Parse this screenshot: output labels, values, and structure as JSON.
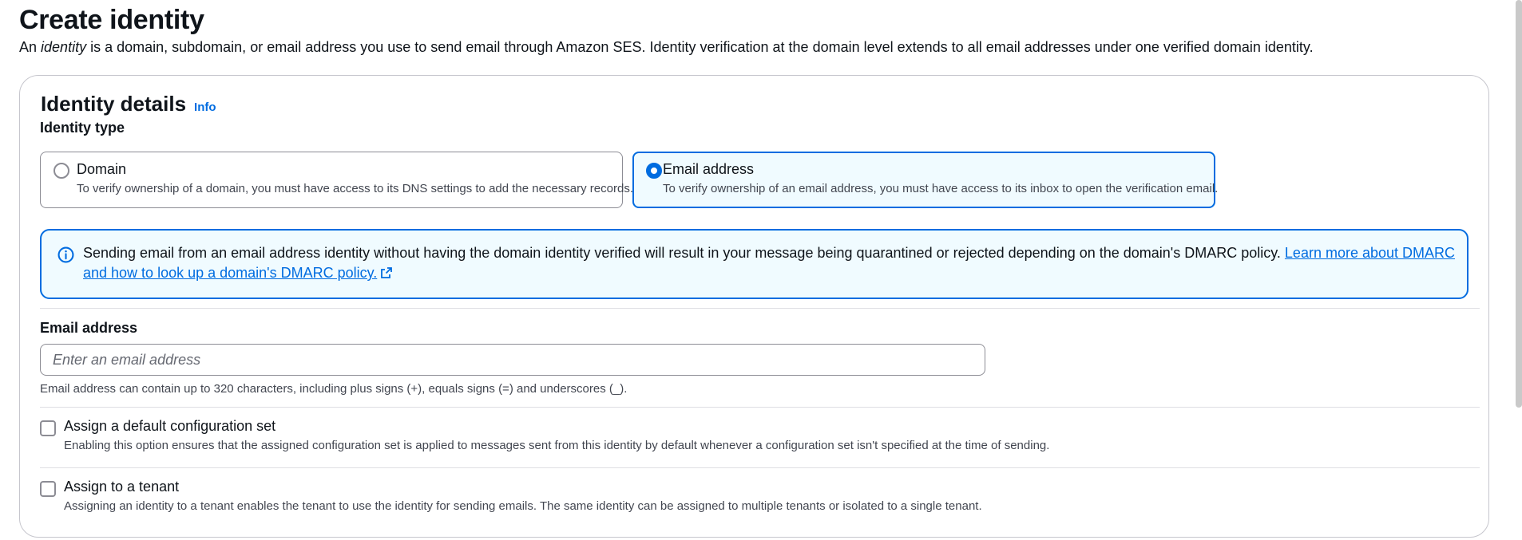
{
  "page": {
    "title": "Create identity",
    "description_prefix": "An ",
    "description_italic": "identity",
    "description_rest": " is a domain, subdomain, or email address you use to send email through Amazon SES. Identity verification at the domain level extends to all email addresses under one verified domain identity."
  },
  "panel": {
    "title": "Identity details",
    "info_label": "Info"
  },
  "identity_type": {
    "label": "Identity type",
    "selected": "email",
    "options": [
      {
        "key": "domain",
        "label": "Domain",
        "description": "To verify ownership of a domain, you must have access to its DNS settings to add the necessary records."
      },
      {
        "key": "email",
        "label": "Email address",
        "description": "To verify ownership of an email address, you must have access to its inbox to open the verification email."
      }
    ]
  },
  "alert": {
    "icon": "info-circle-icon",
    "text": "Sending email from an email address identity without having the domain identity verified will result in your message being quarantined or rejected depending on the domain's DMARC policy. ",
    "link_text": "Learn more about DMARC and how to look up a domain's DMARC policy.",
    "link_icon": "external-link-icon"
  },
  "email_field": {
    "label": "Email address",
    "value": "",
    "placeholder": "Enter an email address",
    "hint": "Email address can contain up to 320 characters, including plus signs (+), equals signs (=) and underscores (_)."
  },
  "config_set": {
    "checked": false,
    "label": "Assign a default configuration set",
    "description": "Enabling this option ensures that the assigned configuration set is applied to messages sent from this identity by default whenever a configuration set isn't specified at the time of sending."
  },
  "tenant": {
    "checked": false,
    "label": "Assign to a tenant",
    "description": "Assigning an identity to a tenant enables the tenant to use the identity for sending emails. The same identity can be assigned to multiple tenants or isolated to a single tenant."
  },
  "colors": {
    "accent": "#006ce0",
    "selected_bg": "#f0fbff",
    "border": "#8c8c94",
    "text": "#0f141a",
    "secondary_text": "#424650"
  }
}
